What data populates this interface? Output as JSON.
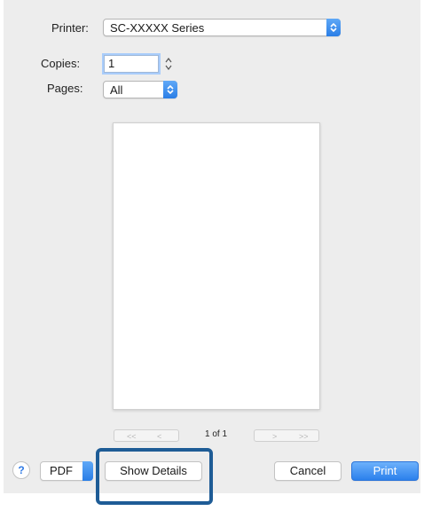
{
  "printer": {
    "label": "Printer:",
    "value": "SC-XXXXX Series"
  },
  "copies": {
    "label": "Copies:",
    "value": "1"
  },
  "pages": {
    "label": "Pages:",
    "value": "All"
  },
  "navigation": {
    "first": "<<",
    "prev": "<",
    "page_indicator": "1 of 1",
    "next": ">",
    "last": ">>"
  },
  "footer": {
    "help": "?",
    "pdf": "PDF",
    "show_details": "Show Details",
    "cancel": "Cancel",
    "print": "Print"
  },
  "colors": {
    "accent": "#2a7ee6",
    "highlight_box": "#1e5c96",
    "dialog_bg": "#ededed"
  }
}
